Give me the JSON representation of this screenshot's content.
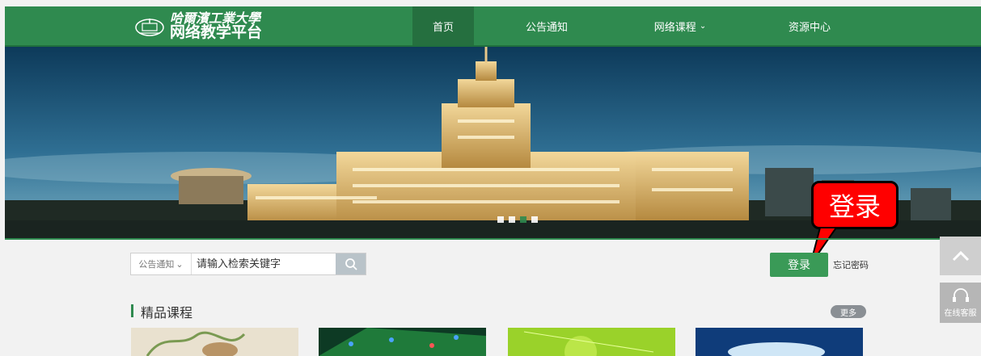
{
  "brand": {
    "school_name": "哈爾濱工業大學",
    "platform_name": "网络教学平台",
    "emblem_icon": "university-emblem-icon"
  },
  "nav": {
    "items": [
      {
        "label": "首页",
        "active": true
      },
      {
        "label": "公告通知",
        "active": false
      },
      {
        "label": "网络课程",
        "active": false,
        "has_dropdown": true
      },
      {
        "label": "资源中心",
        "active": false
      }
    ]
  },
  "banner": {
    "slide_count": 4,
    "active_slide": 3
  },
  "annotation": {
    "callout_text": "登录",
    "callout_color": "#ff0000"
  },
  "search": {
    "category": "公告通知",
    "placeholder": "请输入检索关键字",
    "button_icon": "search-icon"
  },
  "account": {
    "login_label": "登录",
    "forgot_label": "忘记密码"
  },
  "section": {
    "title": "精品课程",
    "more_label": "更多"
  },
  "side": {
    "back_to_top_icon": "chevron-up-icon",
    "service_icon": "headset-icon",
    "service_label": "在线客服"
  },
  "colors": {
    "primary_green": "#2f8a4f",
    "page_bg": "#f2f2f2",
    "login_green": "#3a9a57"
  }
}
